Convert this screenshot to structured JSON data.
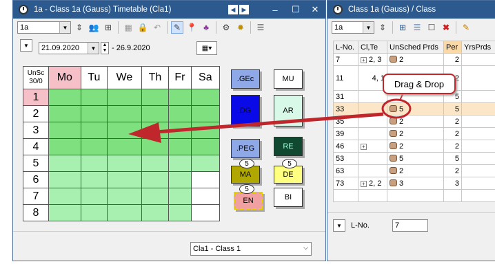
{
  "left_window": {
    "title": "1a - Class 1a (Gauss)  Timetable  (Cla1)",
    "class_select": "1a",
    "date_from": "21.09.2020",
    "date_to": "- 26.9.2020",
    "corner_line1": "UnSc",
    "corner_line2": "30/0",
    "days": [
      "Mo",
      "Tu",
      "We",
      "Th",
      "Fr",
      "Sa"
    ],
    "periods": [
      "1",
      "2",
      "3",
      "4",
      "5",
      "6",
      "7",
      "8"
    ],
    "footer_select": "Cla1 - Class 1",
    "cards": [
      {
        "label": ".GEc",
        "color": "#8fa8e8"
      },
      {
        "label": "MU",
        "color": "#ffffff"
      },
      {
        "label": "DG",
        "color": "#0a0ae8"
      },
      {
        "label": "AR",
        "color": "#d8f8e8"
      },
      {
        "label": ".PEG",
        "color": "#8fa8e8"
      },
      {
        "label": "RE",
        "color": "#104830"
      },
      {
        "label": "MA",
        "color": "#b0a800",
        "badge": "5"
      },
      {
        "label": "DE",
        "color": "#ffff80",
        "badge": "5"
      },
      {
        "label": "EN",
        "color": "#f0a0a0",
        "badge": "5"
      },
      {
        "label": "BI",
        "color": "#ffffff"
      }
    ]
  },
  "right_window": {
    "title": "Class 1a (Gauss) / Class",
    "class_select": "1a",
    "columns": [
      "L-No.",
      "Cl,Te",
      "UnSched Prds",
      "Per",
      "YrsPrds"
    ],
    "rows": [
      {
        "lno": "7",
        "clte": "2, 3",
        "expand": true,
        "unsched": "2",
        "per": "2"
      },
      {
        "lno": "11",
        "clte": "4, 1",
        "expand": false,
        "unsched": "",
        "per": "2"
      },
      {
        "lno": "31",
        "clte": "",
        "expand": false,
        "unsched": "",
        "per": "5"
      },
      {
        "lno": "33",
        "clte": "",
        "expand": false,
        "unsched": "5",
        "per": "5",
        "selected": true
      },
      {
        "lno": "35",
        "clte": "",
        "expand": false,
        "unsched": "2",
        "per": "2"
      },
      {
        "lno": "39",
        "clte": "",
        "expand": false,
        "unsched": "2",
        "per": "2"
      },
      {
        "lno": "46",
        "clte": "",
        "expand": true,
        "unsched": "2",
        "per": "2"
      },
      {
        "lno": "53",
        "clte": "",
        "expand": false,
        "unsched": "5",
        "per": "5"
      },
      {
        "lno": "63",
        "clte": "",
        "expand": false,
        "unsched": "2",
        "per": "2"
      },
      {
        "lno": "73",
        "clte": "2, 2",
        "expand": true,
        "unsched": "3",
        "per": "3"
      }
    ],
    "footer_label": "L-No.",
    "footer_value": "7"
  },
  "callout_text": "Drag & Drop",
  "colors": {
    "titlebar": "#2d5a8e",
    "arrow": "#c0272d",
    "green": "#7fe07f",
    "light_green": "#a8f0b0",
    "monday": "#f5c0c8"
  }
}
